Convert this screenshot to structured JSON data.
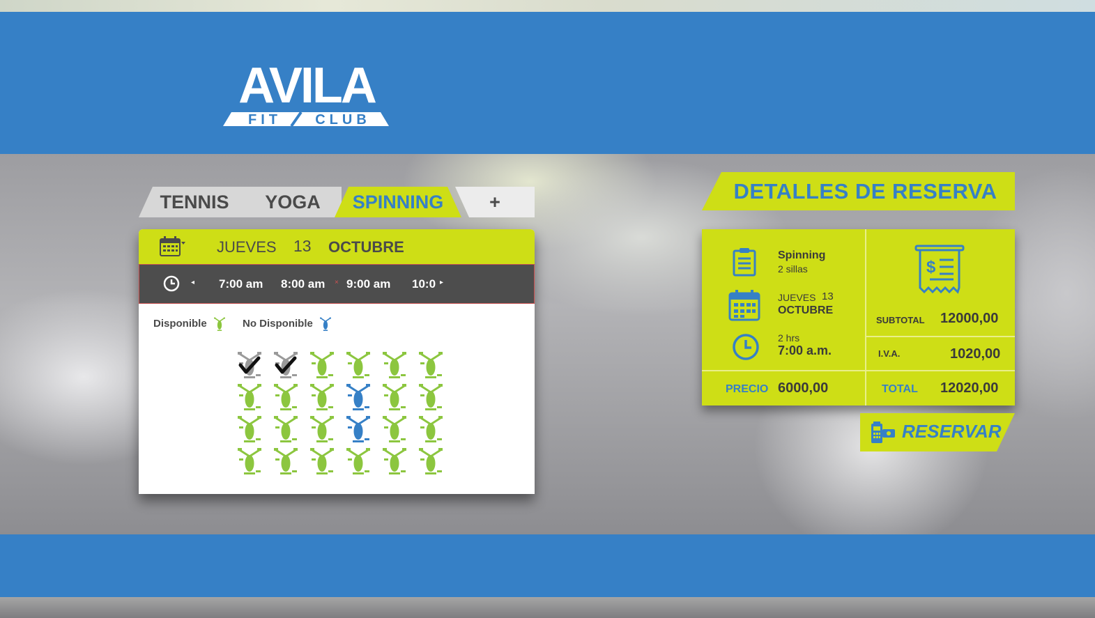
{
  "brand": {
    "logo_word": "AVILA",
    "logo_sub": "FIT / CLUB"
  },
  "tabs": [
    {
      "label": "TENNIS",
      "active": false
    },
    {
      "label": "YOGA",
      "active": false
    },
    {
      "label": "SPINNING",
      "active": true
    },
    {
      "label": "+",
      "active": false
    }
  ],
  "date": {
    "weekday": "JUEVES",
    "day": "13",
    "month": "OCTUBRE"
  },
  "times": {
    "slots": [
      "7:00 am",
      "8:00 am",
      "9:00 am",
      "10:0"
    ],
    "prev_arrow": "◂",
    "next_arrow": "▸",
    "marker": "×"
  },
  "legend": {
    "available": "Disponible",
    "unavailable": "No Disponible"
  },
  "seats": [
    [
      "selected",
      "selected",
      "available",
      "available",
      "available",
      "available"
    ],
    [
      "available",
      "available",
      "available",
      "unavailable",
      "available",
      "available"
    ],
    [
      "available",
      "available",
      "available",
      "unavailable",
      "available",
      "available"
    ],
    [
      "available",
      "available",
      "available",
      "available",
      "available",
      "available"
    ]
  ],
  "colors": {
    "accent": "#cede16",
    "brand_blue": "#3680c6",
    "available": "#8cc63f",
    "unavailable": "#3680c6",
    "selected": "#9a9a9a"
  },
  "details": {
    "title": "DETALLES DE RESERVA",
    "activity": "Spinning",
    "seats_text": "2 sillas",
    "weekday": "JUEVES",
    "day": "13",
    "month": "OCTUBRE",
    "duration": "2 hrs",
    "time": "7:00 a.m.",
    "price_label": "PRECIO",
    "price_value": "6000,00",
    "subtotal_label": "SUBTOTAL",
    "subtotal_value": "12000,00",
    "iva_label": "I.V.A.",
    "iva_value": "1020,00",
    "total_label": "TOTAL",
    "total_value": "12020,00"
  },
  "reserve_button": {
    "label": "RESERVAR"
  }
}
